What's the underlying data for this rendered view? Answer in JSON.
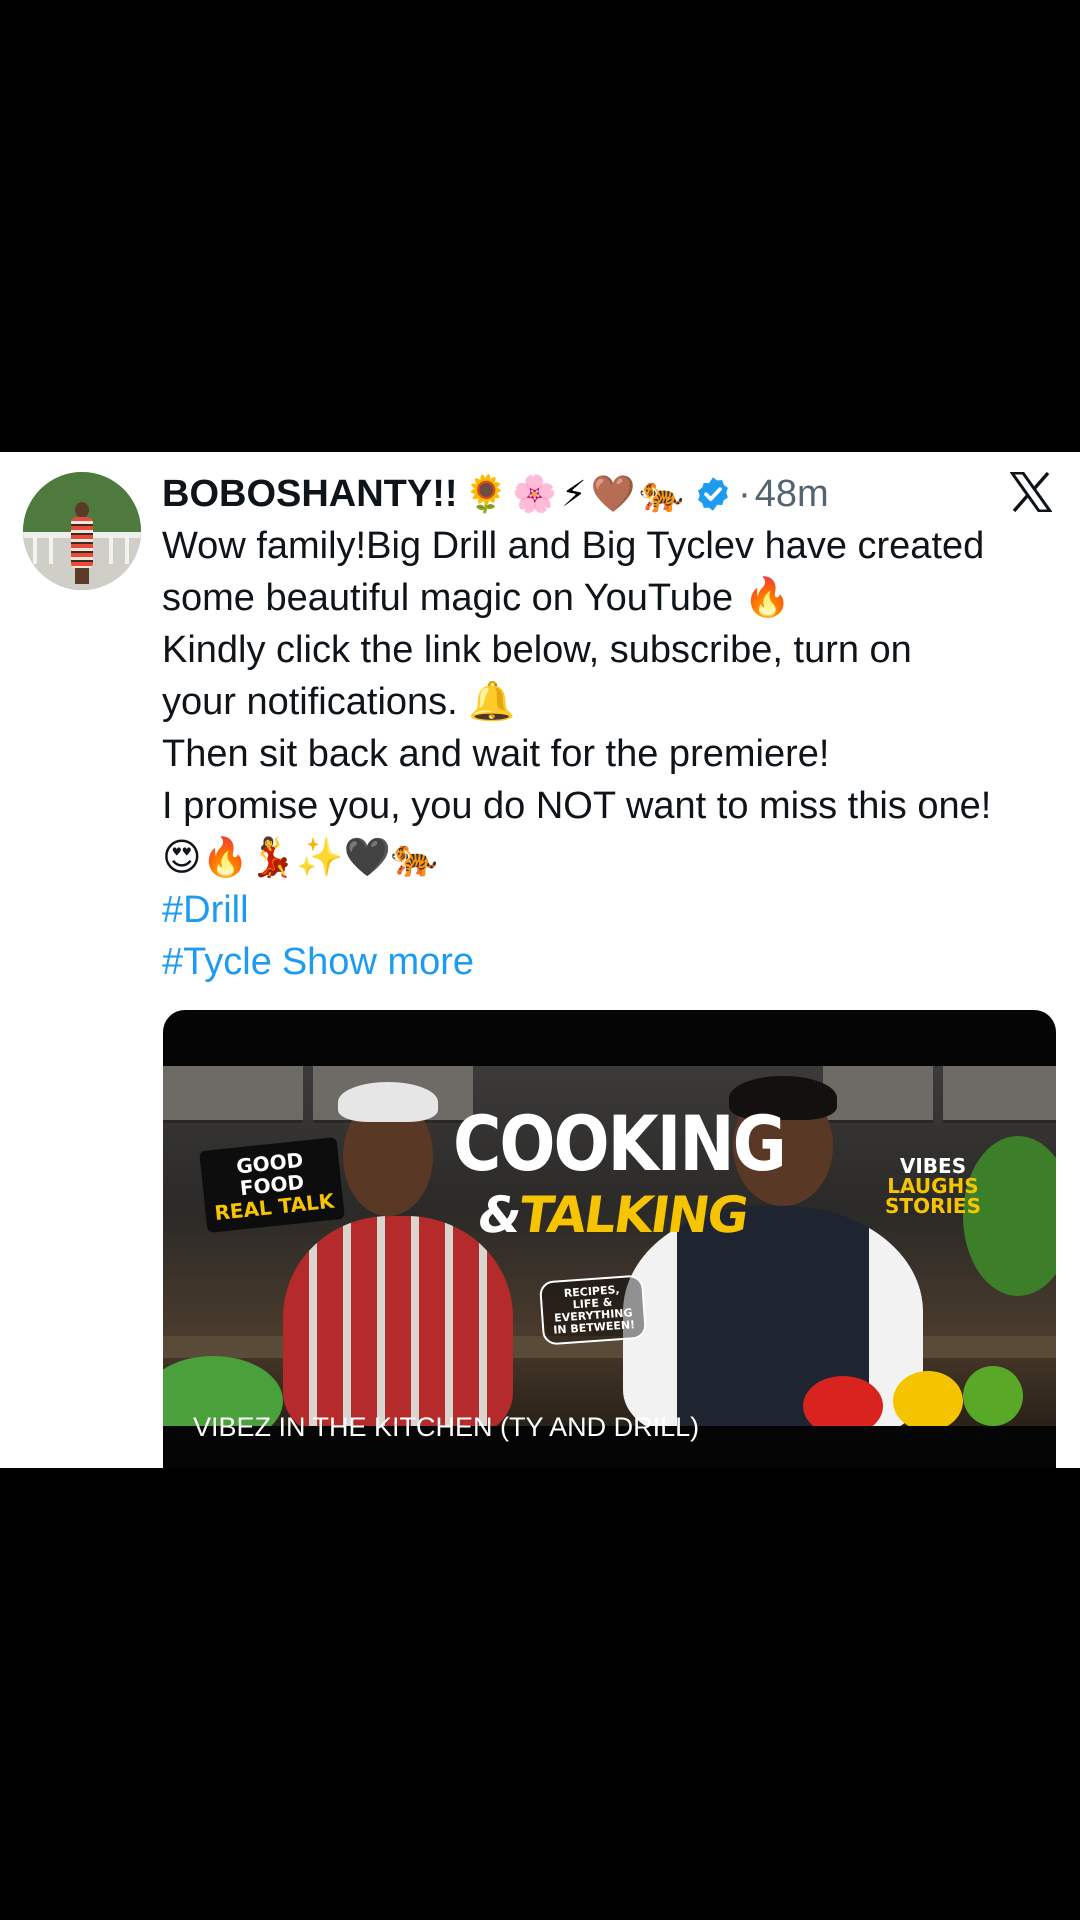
{
  "tweet": {
    "display_name": "BOBOSHANTY!!",
    "name_emojis": "🌻🌸⚡🤎🐅",
    "timestamp": "48m",
    "separator": "·",
    "lines": [
      "Wow family!Big Drill and Big Tyclev have created",
      "some beautiful magic on YouTube 🔥",
      "Kindly click the link below, subscribe,  turn on",
      "your notifications. 🔔",
      "Then sit back and wait for the premiere!",
      "I promise you, you do NOT want to miss this one!",
      "😍🔥💃✨🖤🐅"
    ],
    "hashtags": [
      "#Drill",
      "#Tycle"
    ],
    "show_more": "Show more"
  },
  "card": {
    "title": "VIBEZ IN THE KITCHEN (TY AND DRILL)",
    "thumbnail": {
      "headline": "COOKING",
      "subheadline_amp": "&",
      "subheadline": "TALKING",
      "sticker_left_line1": "GOOD FOOD",
      "sticker_left_line2": "REAL TALK",
      "sticker_right": [
        "VIBES",
        "LAUGHS",
        "STORIES"
      ],
      "sticker_center": [
        "RECIPES,",
        "LIFE &",
        "EVERYTHING",
        "IN BETWEEN!"
      ]
    }
  },
  "icons": {
    "verified": "verified-badge-icon",
    "platform": "x-logo-icon"
  },
  "colors": {
    "link": "#1d9bf0",
    "text": "#0f1419",
    "secondary": "#536471",
    "accent_yellow": "#f6c400"
  }
}
